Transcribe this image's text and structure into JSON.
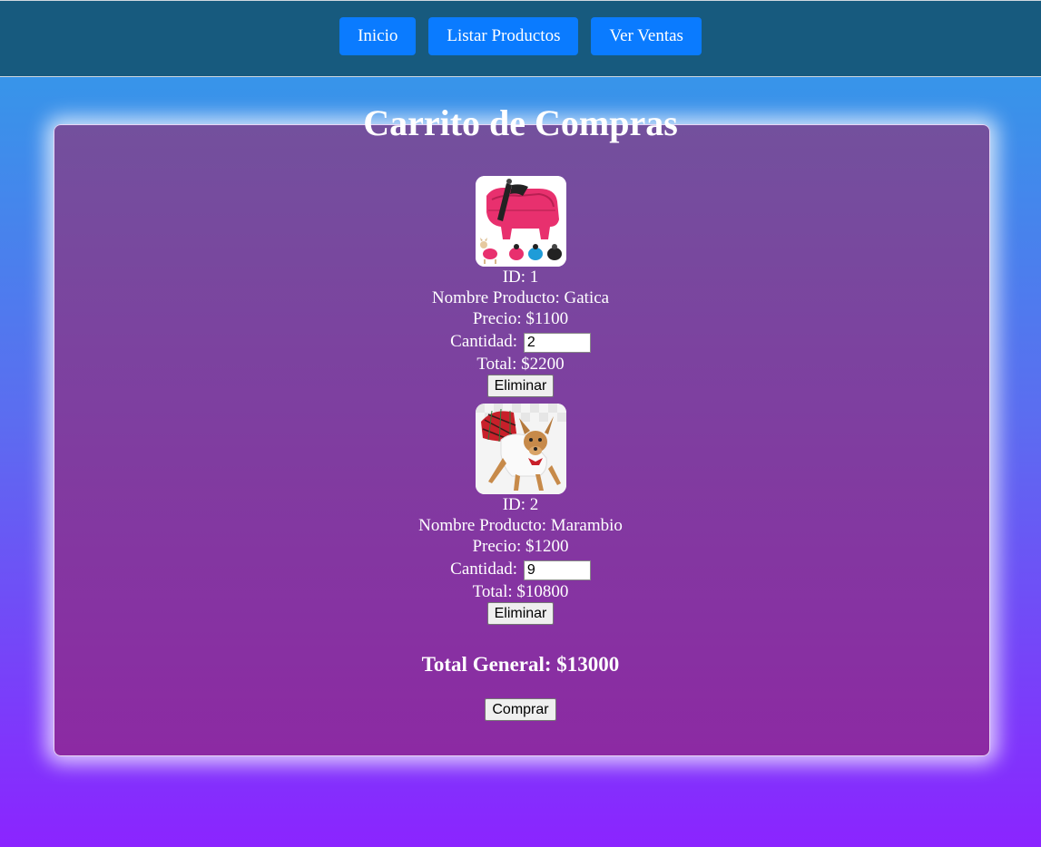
{
  "nav": {
    "items": [
      "Inicio",
      "Listar Productos",
      "Ver Ventas"
    ]
  },
  "cart": {
    "title": "Carrito de Compras",
    "items": [
      {
        "id_text": "ID: 1",
        "name_text": "Nombre Producto: Gatica",
        "price_text": "Precio: $1100",
        "qty_label": "Cantidad:",
        "qty_value": "2",
        "total_text": "Total: $2200",
        "remove_label": "Eliminar",
        "image_subject": "pink-dog-jacket"
      },
      {
        "id_text": "ID: 2",
        "name_text": "Nombre Producto: Marambio",
        "price_text": "Precio: $1200",
        "qty_label": "Cantidad:",
        "qty_value": "9",
        "total_text": "Total: $10800",
        "remove_label": "Eliminar",
        "image_subject": "dog-red-plaid-dress"
      }
    ],
    "grand_total": "Total General: $13000",
    "buy_label": "Comprar"
  },
  "colors": {
    "navbar": "#175a7e",
    "nav_button": "#0a7bff",
    "card_top": "#73509d",
    "card_bottom": "#8c2aa3"
  }
}
